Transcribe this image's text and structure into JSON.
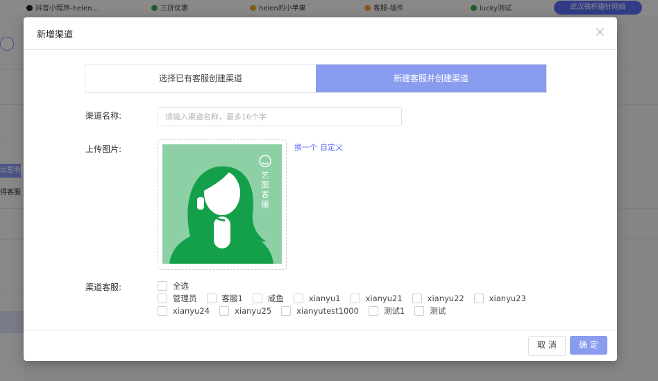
{
  "background": {
    "tabs": [
      {
        "label": "抖音小程序-helen...",
        "icon": "tiktok-icon",
        "color": "#222222"
      },
      {
        "label": "三拼优惠",
        "icon": "wechat-icon",
        "color": "#3aa94a"
      },
      {
        "label": "helen的小苹果",
        "icon": "leaf-icon",
        "color": "#f0a030"
      },
      {
        "label": "客服-插件",
        "icon": "plugin-icon",
        "color": "#f0a030"
      },
      {
        "label": "lucky测试",
        "icon": "wechat-icon",
        "color": "#3aa94a"
      }
    ],
    "pill_label": "武汉铁杆趣针网络",
    "left_text_1": "比星明",
    "left_text_2": "得客服"
  },
  "modal": {
    "title": "新增渠道",
    "close_icon": "close-icon",
    "segment": {
      "option_existing": "选择已有客服创建渠道",
      "option_new": "新建客服并创建渠道",
      "active": "option_new"
    },
    "channel_name": {
      "label": "渠道名称:",
      "value": "",
      "placeholder": "请输入渠道名称，最多16个字"
    },
    "upload": {
      "label": "上传图片:",
      "link_switch": "换一个",
      "link_custom": "自定义",
      "avatar_vertical_text": "艺图客服"
    },
    "agents": {
      "label": "渠道客服:",
      "select_all": "全选",
      "rows": [
        [
          "管理员",
          "客服1",
          "咸鱼",
          "xianyu1",
          "xianyu21",
          "xianyu22",
          "xianyu23"
        ],
        [
          "xianyu24",
          "xianyu25",
          "xianyutest1000",
          "测试1",
          "测试"
        ]
      ]
    },
    "footer": {
      "cancel_label": "取 消",
      "ok_label": "确 定"
    }
  },
  "colors": {
    "accent": "#8a9cf0",
    "link": "#5b6ef5",
    "avatar_bg": "#8dd0a6",
    "avatar_green": "#14a04a"
  }
}
